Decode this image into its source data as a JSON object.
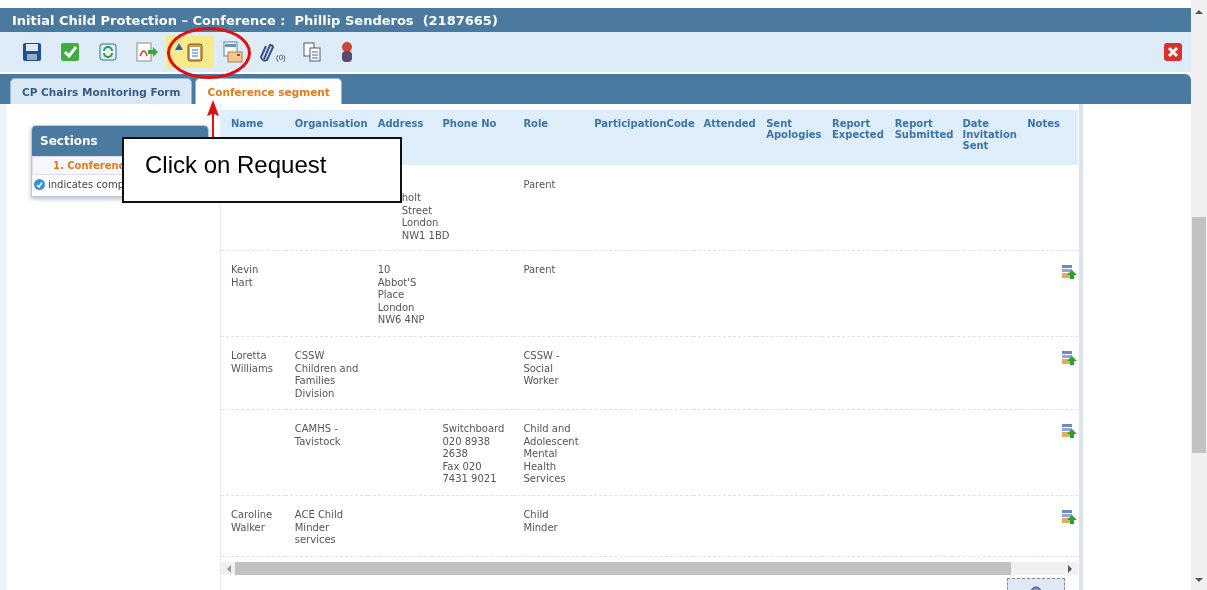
{
  "window": {
    "title": "Initial Child Protection – Conference :  Phillip Senderos  (2187665)"
  },
  "toolbar": [
    {
      "kind": "save",
      "selected": false
    },
    {
      "kind": "approve",
      "selected": false
    },
    {
      "kind": "refresh",
      "selected": false
    },
    {
      "kind": "pdf",
      "selected": false
    },
    {
      "kind": "request",
      "selected": true
    },
    {
      "kind": "envelope",
      "selected": false
    },
    {
      "kind": "attach",
      "selected": false,
      "count": "(0)"
    },
    {
      "kind": "copy",
      "selected": false
    },
    {
      "kind": "person",
      "selected": false
    }
  ],
  "tabs": [
    {
      "label": "CP Chairs Monitoring Form",
      "selected": false
    },
    {
      "label": "Conference segment",
      "selected": true
    }
  ],
  "sections": {
    "title": "Sections",
    "items": [
      {
        "label": "1.  Conferenc",
        "selected": true
      }
    ],
    "legend": "indicates comp"
  },
  "table": {
    "columns": [
      "Name",
      "Organisation",
      "Address",
      "Phone No",
      "Role",
      "ParticipationCode",
      "Attended",
      "Sent\nApologies",
      "Report\nExpected",
      "Report\nSubmitted",
      "Date\nInvitation\nSent",
      "Notes"
    ],
    "rows": [
      {
        "name": "",
        "organisation": "",
        "address": "holt\nStreet\nLondon\nNW1 1BD",
        "phone": "",
        "role": "Parent",
        "note": false
      },
      {
        "name": "Kevin\nHart",
        "organisation": "",
        "address": "10\nAbbot'S\nPlace\nLondon\nNW6 4NP",
        "phone": "",
        "role": "Parent",
        "note": true
      },
      {
        "name": "Loretta\nWilliams",
        "organisation": "CSSW\nChildren and\nFamilies\nDivision",
        "address": "",
        "phone": "",
        "role": "CSSW -\nSocial\nWorker",
        "note": true
      },
      {
        "name": "",
        "organisation": "CAMHS -\nTavistock",
        "address": "",
        "phone": "Switchboard\n020 8938\n2638\nFax 020\n7431 9021",
        "role": "Child and\nAdolescent\nMental\nHealth\nServices",
        "note": true
      },
      {
        "name": "Caroline\nWalker",
        "organisation": "ACE Child\nMinder\nservices",
        "address": "",
        "phone": "",
        "role": "Child\nMinder",
        "note": true
      }
    ]
  },
  "annotation": {
    "callout": "Click on Request"
  }
}
